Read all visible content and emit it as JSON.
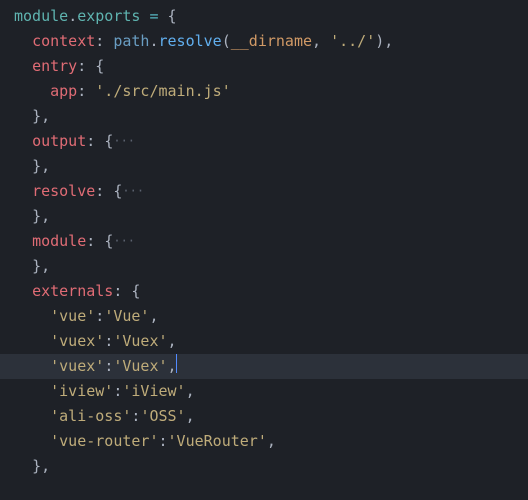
{
  "code": {
    "moduleVar": "module",
    "dot": ".",
    "exportsVar": "exports",
    "eq": " = ",
    "openBrace": "{",
    "closeBrace": "}",
    "closeBraceComma": "},",
    "openParen": "(",
    "closeParen": ")",
    "comma": ",",
    "contextProp": "context",
    "colon": ": ",
    "colonTight": ":",
    "pathVar": "path",
    "resolveMethod": "resolve",
    "dirname": "__dirname",
    "space": ", ",
    "parentDir": "'../'",
    "entryProp": "entry",
    "appProp": "app",
    "mainJs": "'./src/main.js'",
    "outputProp": "output",
    "resolveProp": "resolve",
    "moduleProp": "module",
    "externalsProp": "externals",
    "foldDots": "···",
    "ext1k": "'vue'",
    "ext1v": "'Vue'",
    "ext2k": "'vuex'",
    "ext2v": "'Vuex'",
    "ext3k": "'vuex'",
    "ext3v": "'Vuex'",
    "ext4k": "'iview'",
    "ext4v": "'iView'",
    "ext5k": "'ali-oss'",
    "ext5v": "'OSS'",
    "ext6k": "'vue-router'",
    "ext6v": "'VueRouter'"
  }
}
